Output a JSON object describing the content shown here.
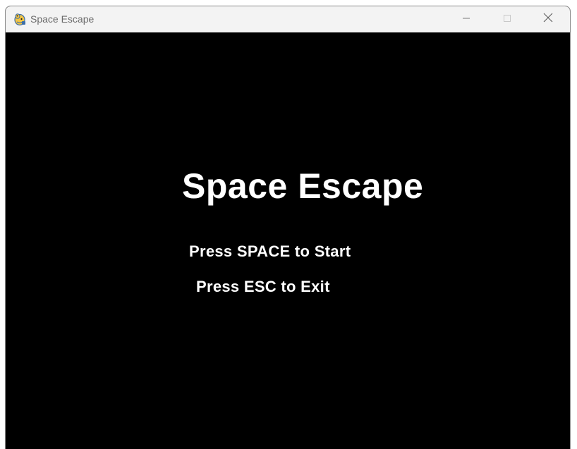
{
  "window": {
    "title": "Space Escape",
    "app_icon": "pygame-snake-icon",
    "controls": {
      "minimize_icon": "minimize-icon",
      "maximize_icon": "maximize-icon",
      "close_icon": "close-icon"
    }
  },
  "game": {
    "title": "Space Escape",
    "start_prompt": "Press SPACE to Start",
    "exit_prompt": "Press ESC to Exit",
    "background_color": "#000000",
    "text_color": "#ffffff"
  }
}
